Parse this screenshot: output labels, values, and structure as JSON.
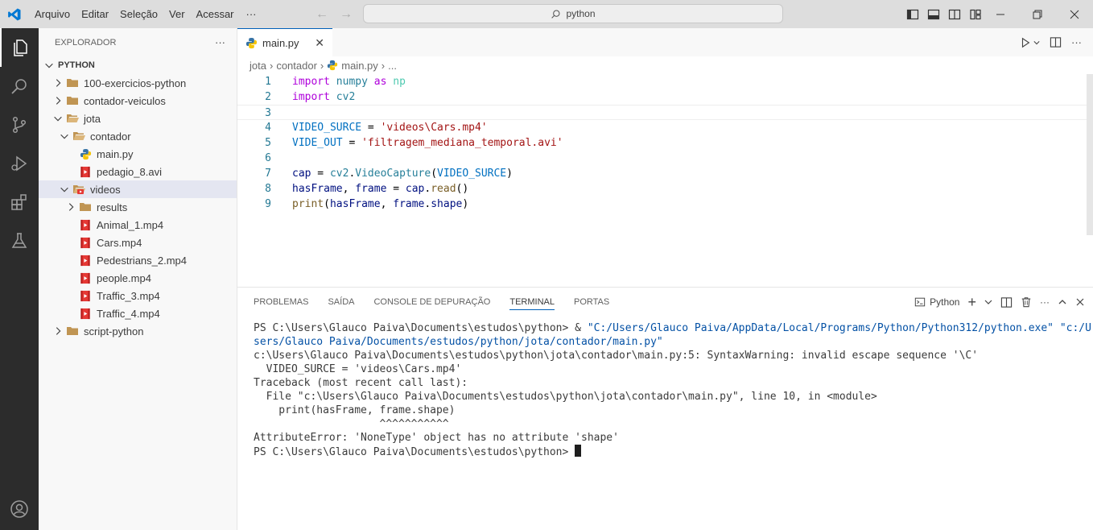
{
  "titlebar": {
    "menu": [
      "Arquivo",
      "Editar",
      "Seleção",
      "Ver",
      "Acessar"
    ],
    "more": "···",
    "search": "python"
  },
  "colors": {
    "accent": "#005fb8",
    "vscode_blue": "#0078d4",
    "activity_bg": "#2c2c2c"
  },
  "sidebar": {
    "title": "EXPLORADOR",
    "more": "···",
    "root": "PYTHON",
    "items": [
      {
        "label": "100-exercicios-python",
        "depth": 1,
        "kind": "folder",
        "expanded": false
      },
      {
        "label": "contador-veiculos",
        "depth": 1,
        "kind": "folder",
        "expanded": false
      },
      {
        "label": "jota",
        "depth": 1,
        "kind": "folder",
        "expanded": true
      },
      {
        "label": "contador",
        "depth": 2,
        "kind": "folder",
        "expanded": true
      },
      {
        "label": "main.py",
        "depth": 3,
        "kind": "python"
      },
      {
        "label": "pedagio_8.avi",
        "depth": 3,
        "kind": "video"
      },
      {
        "label": "videos",
        "depth": 2,
        "kind": "video-folder",
        "expanded": true,
        "selected": true
      },
      {
        "label": "results",
        "depth": 3,
        "kind": "folder",
        "expanded": false
      },
      {
        "label": "Animal_1.mp4",
        "depth": 3,
        "kind": "video"
      },
      {
        "label": "Cars.mp4",
        "depth": 3,
        "kind": "video"
      },
      {
        "label": "Pedestrians_2.mp4",
        "depth": 3,
        "kind": "video"
      },
      {
        "label": "people.mp4",
        "depth": 3,
        "kind": "video"
      },
      {
        "label": "Traffic_3.mp4",
        "depth": 3,
        "kind": "video"
      },
      {
        "label": "Traffic_4.mp4",
        "depth": 3,
        "kind": "video"
      },
      {
        "label": "script-python",
        "depth": 1,
        "kind": "folder",
        "expanded": false
      }
    ]
  },
  "editor": {
    "tab": "main.py",
    "breadcrumb": [
      "jota",
      "contador",
      "main.py",
      "..."
    ],
    "lines": [
      {
        "n": "1",
        "tokens": [
          [
            "kw",
            "import"
          ],
          [
            "plain",
            " "
          ],
          [
            "mod",
            "numpy"
          ],
          [
            "plain",
            " "
          ],
          [
            "kw",
            "as"
          ],
          [
            "plain",
            " "
          ],
          [
            "alias",
            "np"
          ]
        ]
      },
      {
        "n": "2",
        "tokens": [
          [
            "kw",
            "import"
          ],
          [
            "plain",
            " "
          ],
          [
            "mod",
            "cv2"
          ]
        ]
      },
      {
        "n": "3",
        "tokens": [],
        "current": true
      },
      {
        "n": "4",
        "tokens": [
          [
            "var",
            "VIDEO_SURCE"
          ],
          [
            "plain",
            " = "
          ],
          [
            "str",
            "'videos\\Cars.mp4'"
          ]
        ]
      },
      {
        "n": "5",
        "tokens": [
          [
            "var",
            "VIDE_OUT"
          ],
          [
            "plain",
            " = "
          ],
          [
            "str",
            "'filtragem_mediana_temporal.avi'"
          ]
        ]
      },
      {
        "n": "6",
        "tokens": []
      },
      {
        "n": "7",
        "tokens": [
          [
            "param",
            "cap"
          ],
          [
            "plain",
            " = "
          ],
          [
            "mod",
            "cv2"
          ],
          [
            "plain",
            "."
          ],
          [
            "mod",
            "VideoCapture"
          ],
          [
            "plain",
            "("
          ],
          [
            "var",
            "VIDEO_SURCE"
          ],
          [
            "plain",
            ")"
          ]
        ]
      },
      {
        "n": "8",
        "tokens": [
          [
            "param",
            "hasFrame"
          ],
          [
            "plain",
            ", "
          ],
          [
            "param",
            "frame"
          ],
          [
            "plain",
            " = "
          ],
          [
            "param",
            "cap"
          ],
          [
            "plain",
            "."
          ],
          [
            "fn",
            "read"
          ],
          [
            "plain",
            "()"
          ]
        ]
      },
      {
        "n": "9",
        "tokens": [
          [
            "fn",
            "print"
          ],
          [
            "plain",
            "("
          ],
          [
            "param",
            "hasFrame"
          ],
          [
            "plain",
            ", "
          ],
          [
            "param",
            "frame"
          ],
          [
            "plain",
            "."
          ],
          [
            "param",
            "shape"
          ],
          [
            "plain",
            ")"
          ]
        ]
      }
    ]
  },
  "panel": {
    "tabs": [
      "PROBLEMAS",
      "SAÍDA",
      "CONSOLE DE DEPURAÇÃO",
      "TERMINAL",
      "PORTAS"
    ],
    "active_tab": "TERMINAL",
    "shell": "Python",
    "terminal": [
      {
        "text": "PS C:\\Users\\Glauco Paiva\\Documents\\estudos\\python> & ",
        "path": "\"C:/Users/Glauco Paiva/AppData/Local/Programs/Python/Python312/python.exe\" \"c:/U"
      },
      {
        "text": "",
        "path": "sers/Glauco Paiva/Documents/estudos/python/jota/contador/main.py\""
      },
      {
        "text": "c:\\Users\\Glauco Paiva\\Documents\\estudos\\python\\jota\\contador\\main.py:5: SyntaxWarning: invalid escape sequence '\\C'"
      },
      {
        "text": "  VIDEO_SURCE = 'videos\\Cars.mp4'"
      },
      {
        "text": "Traceback (most recent call last):"
      },
      {
        "text": "  File \"c:\\Users\\Glauco Paiva\\Documents\\estudos\\python\\jota\\contador\\main.py\", line 10, in <module>"
      },
      {
        "text": "    print(hasFrame, frame.shape)"
      },
      {
        "text": "                    ^^^^^^^^^^^"
      },
      {
        "text": "AttributeError: 'NoneType' object has no attribute 'shape'"
      },
      {
        "text": "PS C:\\Users\\Glauco Paiva\\Documents\\estudos\\python> ",
        "cursor": true
      }
    ]
  }
}
